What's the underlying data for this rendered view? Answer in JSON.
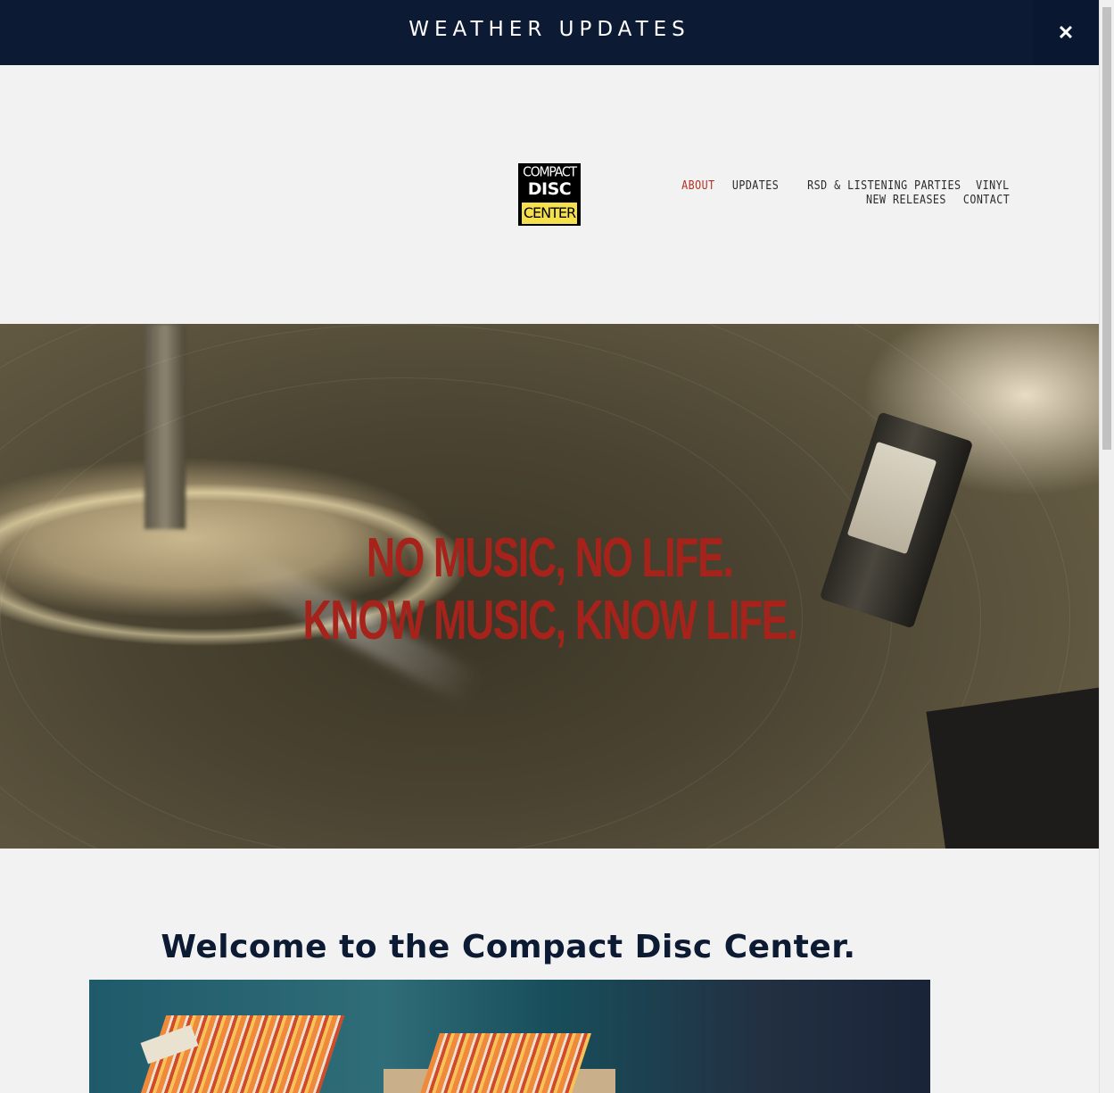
{
  "announcement": {
    "text": "WEATHER UPDATES",
    "close_glyph": "✕"
  },
  "logo": {
    "line1": "COMPACT",
    "line2": "DISC",
    "line3": "CENTER",
    "colors": {
      "background": "#000000",
      "accent": "#f4e04d"
    }
  },
  "nav": {
    "row1": [
      {
        "label": "ABOUT",
        "active": true
      },
      {
        "label": "UPDATES",
        "active": false
      },
      {
        "label": "RSD & LISTENING PARTIES",
        "active": false
      },
      {
        "label": "VINYL",
        "active": false
      }
    ],
    "row2": [
      {
        "label": "NEW RELEASES",
        "active": false
      },
      {
        "label": "CONTACT",
        "active": false
      }
    ],
    "active_color": "#b43327"
  },
  "hero": {
    "line1": "NO MUSIC, NO LIFE.",
    "line2": "KNOW MUSIC, KNOW LIFE.",
    "text_color": "#a6231c"
  },
  "welcome": {
    "heading": "Welcome to the Compact Disc Center."
  },
  "colors": {
    "brand_navy": "#0c1a33",
    "page_background": "#f2f2f2"
  }
}
